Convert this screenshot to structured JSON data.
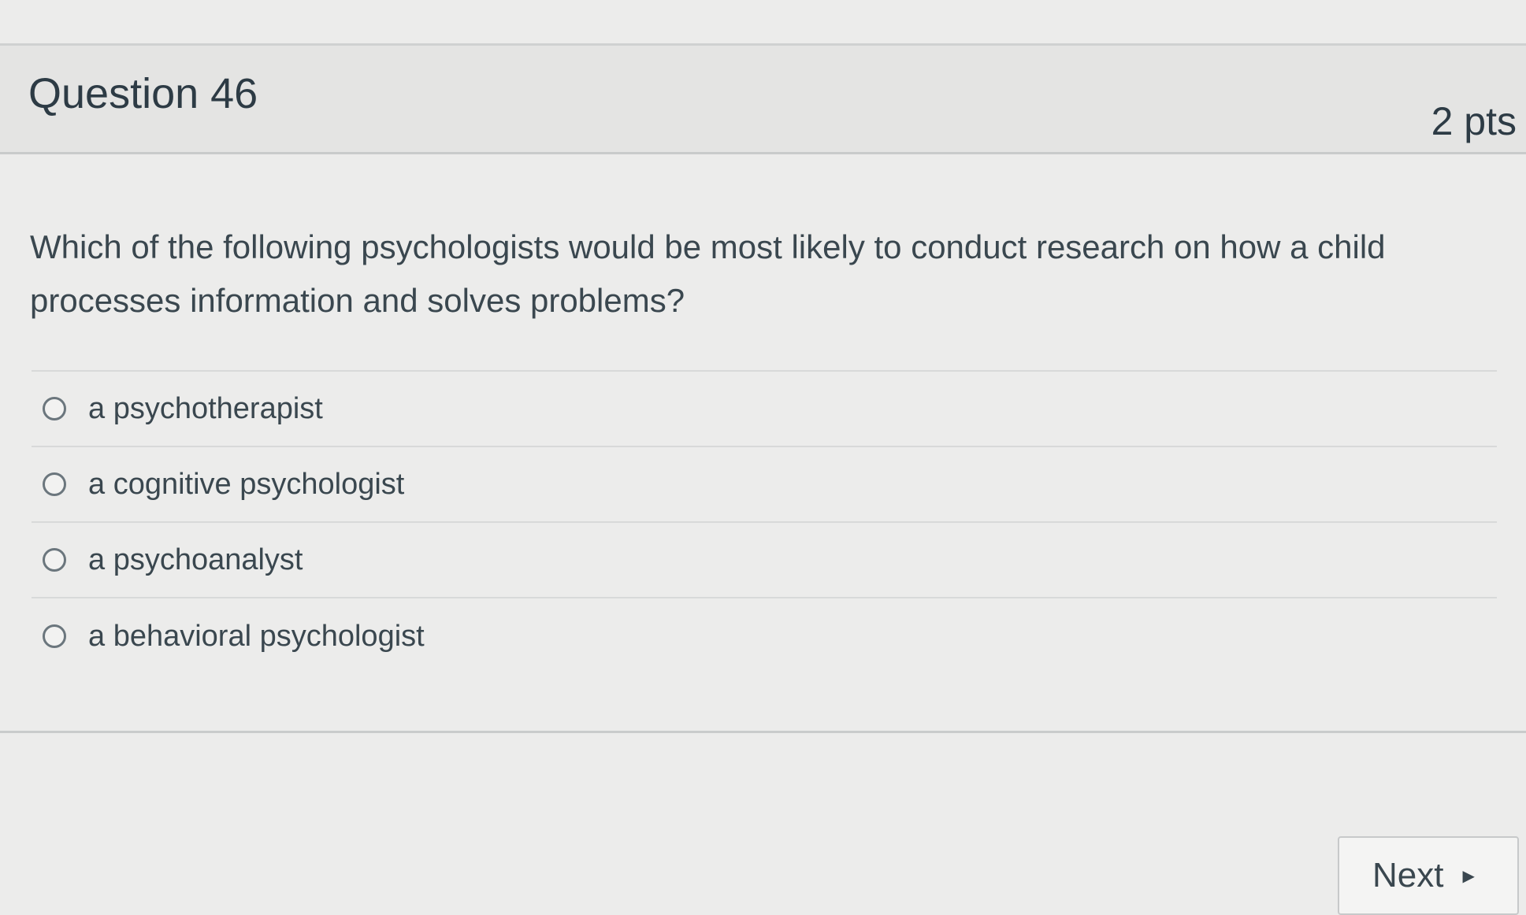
{
  "question": {
    "title": "Question 46",
    "points": "2 pts",
    "text": "Which of the following psychologists would be most likely to conduct research on how a child processes information and solves problems?"
  },
  "answers": [
    {
      "label": "a psychotherapist",
      "selected": false
    },
    {
      "label": "a cognitive psychologist",
      "selected": false
    },
    {
      "label": "a psychoanalyst",
      "selected": false
    },
    {
      "label": "a behavioral psychologist",
      "selected": false
    }
  ],
  "footer": {
    "next_label": "Next",
    "next_icon": "play-triangle-icon"
  },
  "colors": {
    "background": "#ececeb",
    "header_background": "#e4e4e3",
    "text": "#2d3b45"
  }
}
